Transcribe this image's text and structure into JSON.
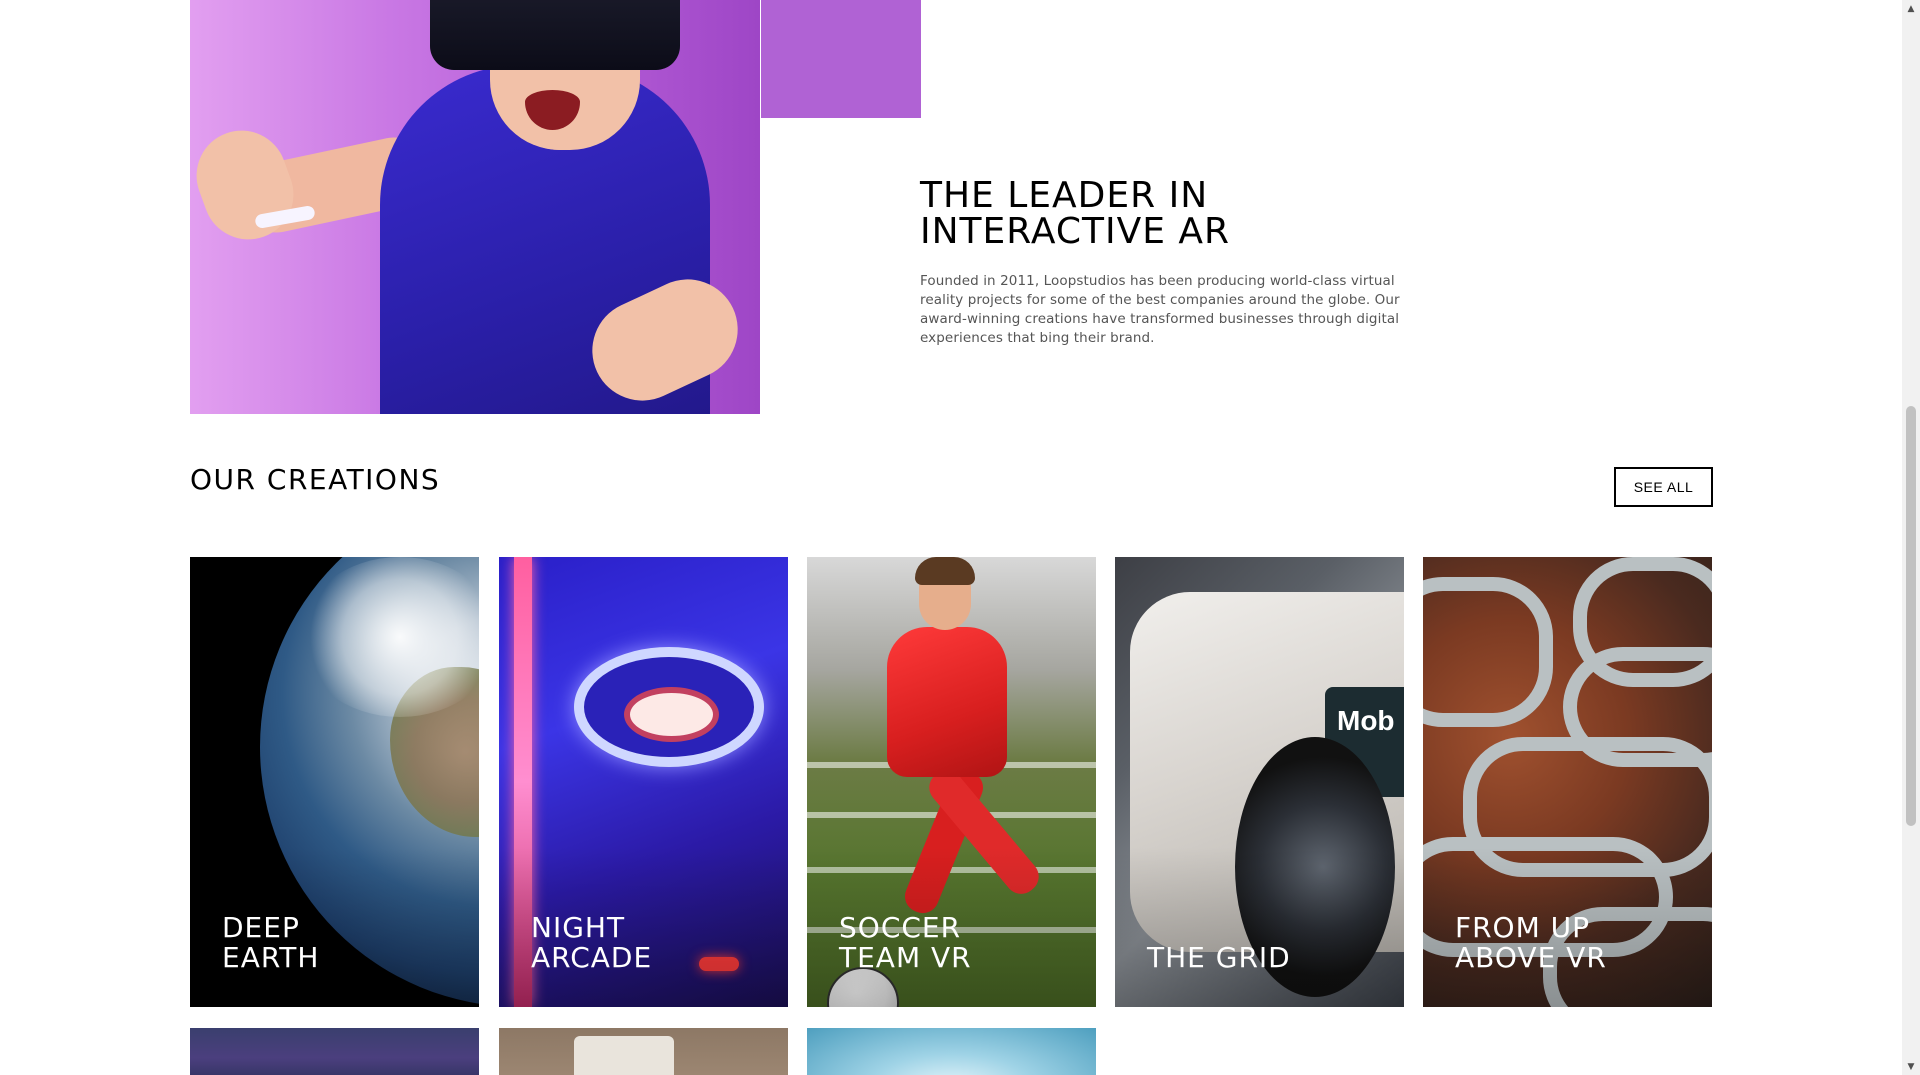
{
  "about": {
    "heading_line1": "THE LEADER IN",
    "heading_line2": "INTERACTIVE AR",
    "body": "Founded in 2011, Loopstudios has been producing world-class virtual reality projects for some of the best companies around the globe. Our award-winning creations have transformed businesses through digital experiences that bing their brand."
  },
  "creations": {
    "title": "OUR CREATIONS",
    "see_all_label": "SEE ALL",
    "items": [
      {
        "line1": "DEEP",
        "line2": "EARTH"
      },
      {
        "line1": "NIGHT",
        "line2": "ARCADE"
      },
      {
        "line1": "SOCCER",
        "line2": "TEAM VR"
      },
      {
        "line1": "",
        "line2": "THE GRID"
      },
      {
        "line1": "FROM UP",
        "line2": "ABOVE VR"
      }
    ],
    "car_brand_text": "Mob"
  },
  "scrollbar": {
    "up_icon": "triangle-up-icon",
    "down_icon": "triangle-down-icon"
  },
  "colors": {
    "accent_purple": "#b35bd6",
    "text_black": "#000000",
    "body_gray": "#555555"
  }
}
